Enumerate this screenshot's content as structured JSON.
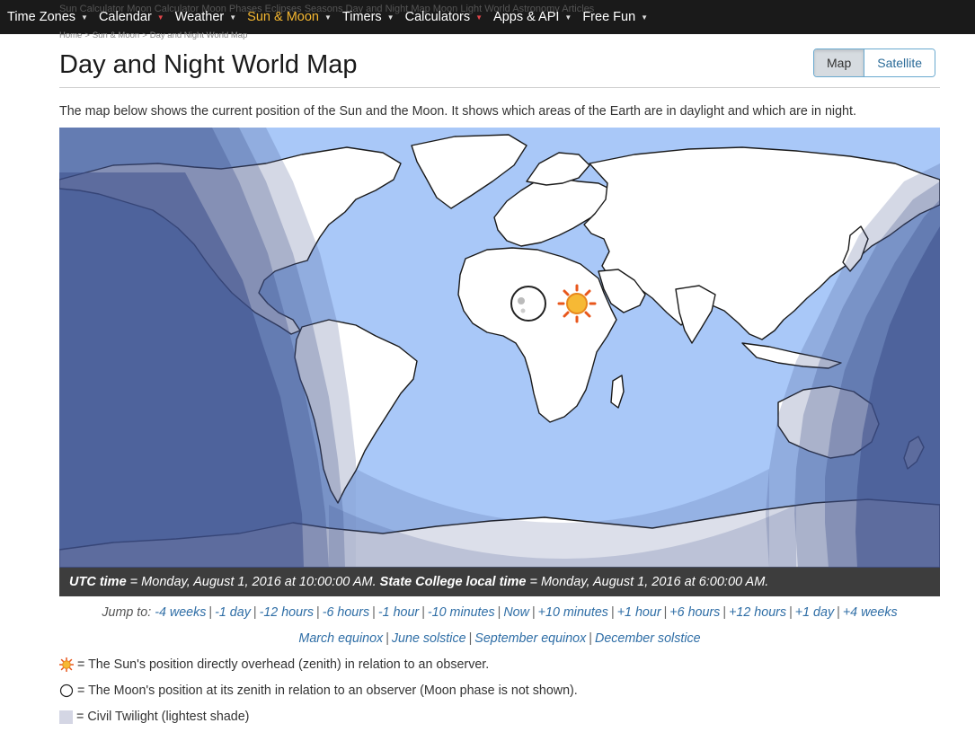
{
  "nav": {
    "ghost_breadcrumb": "Sun Calculator  Moon Calculator  Moon Phases  Eclipses  Seasons  Day and Night Map  Moon Light World  Astronomy Articles",
    "items": [
      {
        "label": "Time Zones"
      },
      {
        "label": "Calendar"
      },
      {
        "label": "Weather"
      },
      {
        "label": "Sun & Moon"
      },
      {
        "label": "Timers"
      },
      {
        "label": "Calculators"
      },
      {
        "label": "Apps & API"
      },
      {
        "label": "Free Fun"
      }
    ],
    "active": "Sun & Moon"
  },
  "breadcrumb": {
    "items": [
      "Home",
      "Sun & Moon",
      "Day and Night World Map"
    ],
    "separator": ">"
  },
  "page": {
    "title": "Day and Night World Map",
    "intro": "The map below shows the current position of the Sun and the Moon. It shows which areas of the Earth are in daylight and which are in night."
  },
  "view_toggle": {
    "map_label": "Map",
    "satellite_label": "Satellite",
    "selected": "Map"
  },
  "map": {
    "colors": {
      "ocean_day": "#a9c8f8",
      "land": "#ffffff",
      "civil_twilight": "#d4d6e4",
      "nautical_twilight": "#a6b0cf",
      "astronomical_twilight": "#7282b4",
      "night": "#45558f"
    },
    "sun_icon": "sun-icon",
    "moon_icon": "moon-icon"
  },
  "time_bar": {
    "utc_label": "UTC time",
    "utc_value": " = Monday, August 1, 2016 at 10:00:00 AM. ",
    "local_label": "State College local time",
    "local_value": " = Monday, August 1, 2016 at 6:00:00 AM."
  },
  "jump": {
    "prefix": "Jump to:",
    "links": [
      "-4 weeks",
      "-1 day",
      "-12 hours",
      "-6 hours",
      "-1 hour",
      "-10 minutes",
      "Now",
      "+10 minutes",
      "+1 hour",
      "+6 hours",
      "+12 hours",
      "+1 day",
      "+4 weeks"
    ],
    "events": [
      "March equinox",
      "June solstice",
      "September equinox",
      "December solstice"
    ]
  },
  "legend": [
    {
      "icon": "sun-icon",
      "text": " = The Sun's position directly overhead (zenith) in relation to an observer."
    },
    {
      "icon": "moon-icon",
      "text": " = The Moon's position at its zenith in relation to an observer (Moon phase is not shown)."
    },
    {
      "icon": "civil-twilight-swatch",
      "text": " = Civil Twilight (lightest shade)"
    }
  ]
}
